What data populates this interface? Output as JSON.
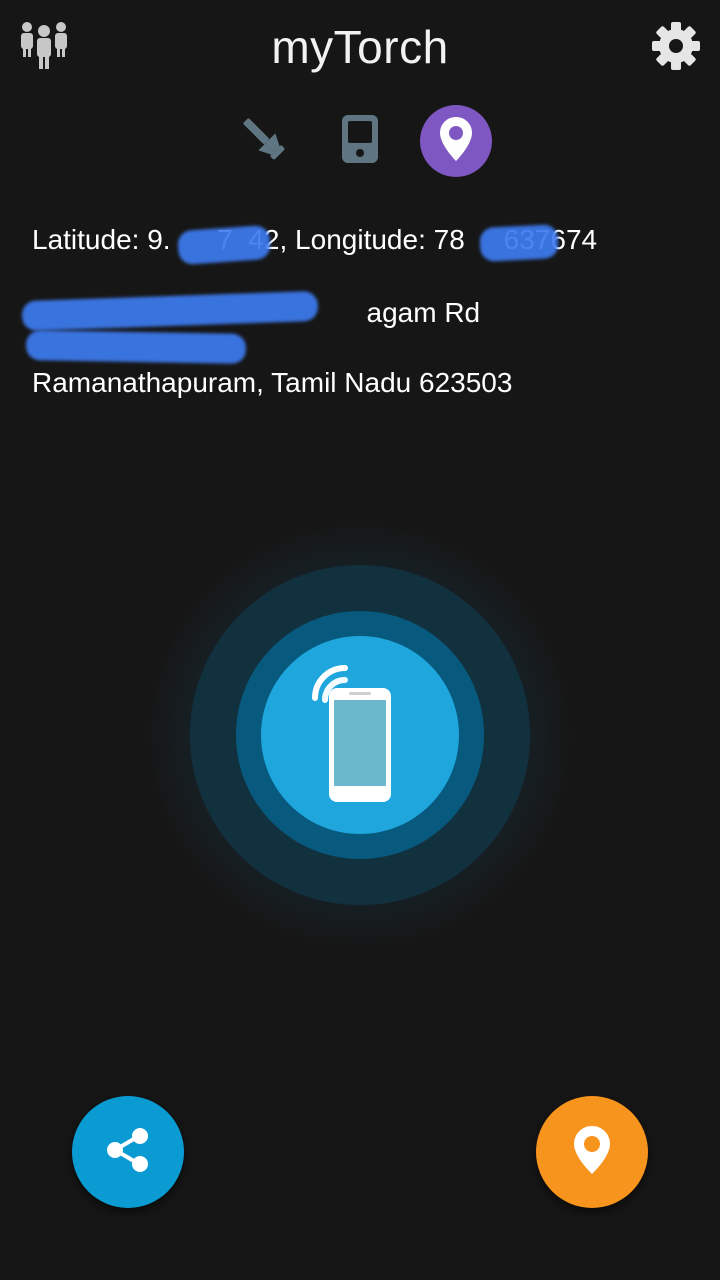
{
  "header": {
    "title": "myTorch",
    "left_icon": "people-group-icon",
    "right_icon": "gear-icon"
  },
  "modes": [
    {
      "name": "flashlight",
      "icon": "flashlight-icon",
      "active": false
    },
    {
      "name": "screen-light",
      "icon": "phone-icon",
      "active": false
    },
    {
      "name": "location",
      "icon": "map-pin-icon",
      "active": true
    }
  ],
  "location": {
    "coordinates": "Latitude: 9.      7  42, Longitude: 78     637674",
    "address_line1": "                                           agam Rd",
    "address_line2": "",
    "address_line3": "Ramanathapuram, Tamil Nadu 623503"
  },
  "center_button": {
    "icon": "phone-signal-icon"
  },
  "fabs": {
    "share": {
      "icon": "share-icon",
      "color": "#0b9bd3"
    },
    "locate": {
      "icon": "map-pin-icon",
      "color": "#f7941d"
    }
  },
  "colors": {
    "background": "#161616",
    "active_mode": "#7e57c2",
    "ring_inner": "#1ea6dd",
    "redaction": "#3d7bf0"
  }
}
